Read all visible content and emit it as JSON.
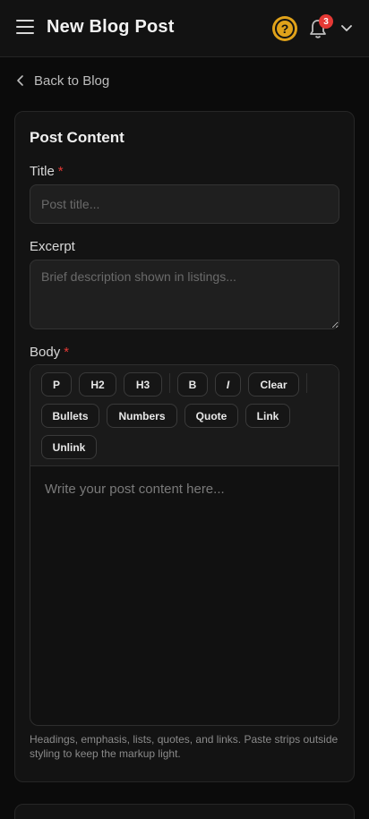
{
  "header": {
    "title": "New Blog Post",
    "notification_count": "3",
    "help_symbol": "?"
  },
  "nav": {
    "back_label": "Back to Blog"
  },
  "post_content": {
    "heading": "Post Content",
    "title_label": "Title",
    "title_placeholder": "Post title...",
    "excerpt_label": "Excerpt",
    "excerpt_placeholder": "Brief description shown in listings...",
    "body_label": "Body",
    "required_marker": "*",
    "toolbar": [
      "P",
      "H2",
      "H3",
      "B",
      "I",
      "Clear",
      "Bullets",
      "Numbers",
      "Quote",
      "Link",
      "Unlink"
    ],
    "body_placeholder": "Write your post content here...",
    "help_text": "Headings, emphasis, lists, quotes, and links. Paste strips outside styling to keep the markup light."
  },
  "colors": {
    "accent": "#e0a21a",
    "badge": "#e53935",
    "required": "#e53935",
    "background": "#0b0b0b",
    "card": "#131313"
  },
  "icons": [
    "menu-icon",
    "help-icon",
    "bell-icon",
    "chevron-down-icon",
    "chevron-left-icon"
  ]
}
